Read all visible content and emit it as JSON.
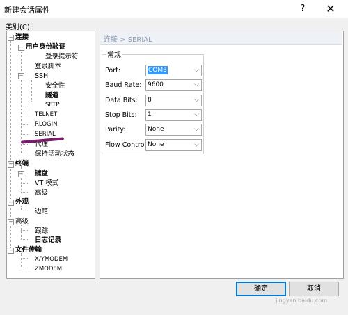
{
  "window": {
    "title": "新建会话属性",
    "help": "?",
    "close": "✕"
  },
  "category_label": "类别(C):",
  "tree": {
    "connection": "连接",
    "auth": "用户身份验证",
    "login_prompts": "登录提示符",
    "login_script": "登录脚本",
    "ssh": "SSH",
    "security": "安全性",
    "tunnel": "隧道",
    "sftp": "SFTP",
    "telnet": "TELNET",
    "rlogin": "RLOGIN",
    "serial": "SERIAL",
    "proxy": "代理",
    "keepalive": "保持活动状态",
    "terminal": "终端",
    "keyboard": "键盘",
    "vt_mode": "VT 模式",
    "advanced_term": "高级",
    "appearance": "外观",
    "margins": "边距",
    "advanced": "高级",
    "tracking": "跟踪",
    "logging": "日志记录",
    "file_transfer": "文件传输",
    "xymodem": "X/YMODEM",
    "zmodem": "ZMODEM"
  },
  "header": "连接 > SERIAL",
  "group": "常规",
  "fields": {
    "port": {
      "label": "Port:",
      "value": "COM3"
    },
    "baud": {
      "label": "Baud Rate:",
      "value": "9600"
    },
    "databits": {
      "label": "Data Bits:",
      "value": "8"
    },
    "stopbits": {
      "label": "Stop Bits:",
      "value": "1"
    },
    "parity": {
      "label": "Parity:",
      "value": "None"
    },
    "flow": {
      "label": "Flow Control:",
      "value": "None"
    }
  },
  "buttons": {
    "ok": "确定",
    "cancel": "取消"
  },
  "watermark": "jingyan.baidu.com",
  "colors": {
    "annotation": "#7a1e6a",
    "selection": "#3399ff",
    "header_text": "#8b9bb0"
  }
}
